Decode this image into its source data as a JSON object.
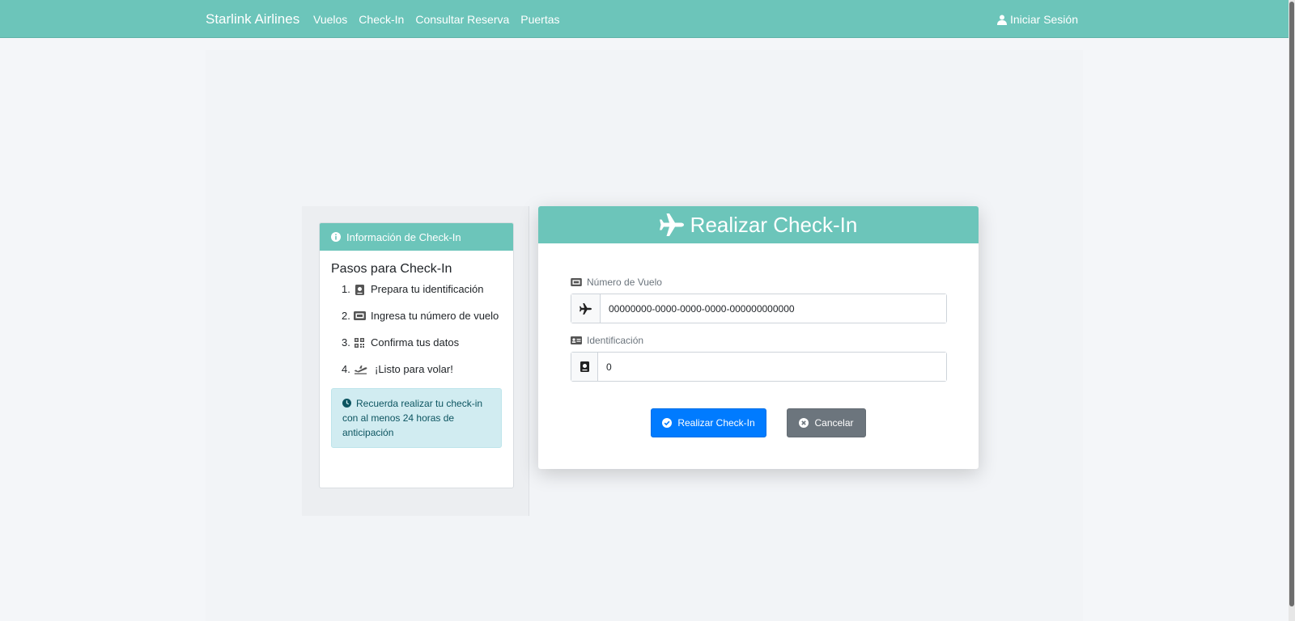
{
  "navbar": {
    "brand": "Starlink Airlines",
    "links": [
      "Vuelos",
      "Check-In",
      "Consultar Reserva",
      "Puertas"
    ],
    "login": "Iniciar Sesión",
    "login_icon": "user-icon"
  },
  "info_panel": {
    "header": "Información de Check-In",
    "header_icon": "info-icon",
    "title": "Pasos para Check-In",
    "steps": [
      {
        "num": "1.",
        "icon": "passport-icon",
        "text": "Prepara tu identificación"
      },
      {
        "num": "2.",
        "icon": "ticket-icon",
        "text": "Ingresa tu número de vuelo"
      },
      {
        "num": "3.",
        "icon": "qrcode-icon",
        "text": "Confirma tus datos"
      },
      {
        "num": "4.",
        "icon": "plane-departure-icon",
        "text": "¡Listo para volar!"
      }
    ],
    "alert": "Recuerda realizar tu check-in con al menos 24 horas de anticipación",
    "alert_icon": "clock-icon"
  },
  "checkin_form": {
    "title": "Realizar Check-In",
    "title_icon": "plane-icon",
    "flight_label": "Número de Vuelo",
    "flight_value": "00000000-0000-0000-0000-000000000000",
    "id_label": "Identificación",
    "id_value": "0",
    "submit_label": "Realizar Check-In",
    "cancel_label": "Cancelar"
  },
  "colors": {
    "brand": "#6cc5ba",
    "primary": "#007bff",
    "secondary": "#6c757d",
    "alert_bg": "#d1ecf1"
  }
}
